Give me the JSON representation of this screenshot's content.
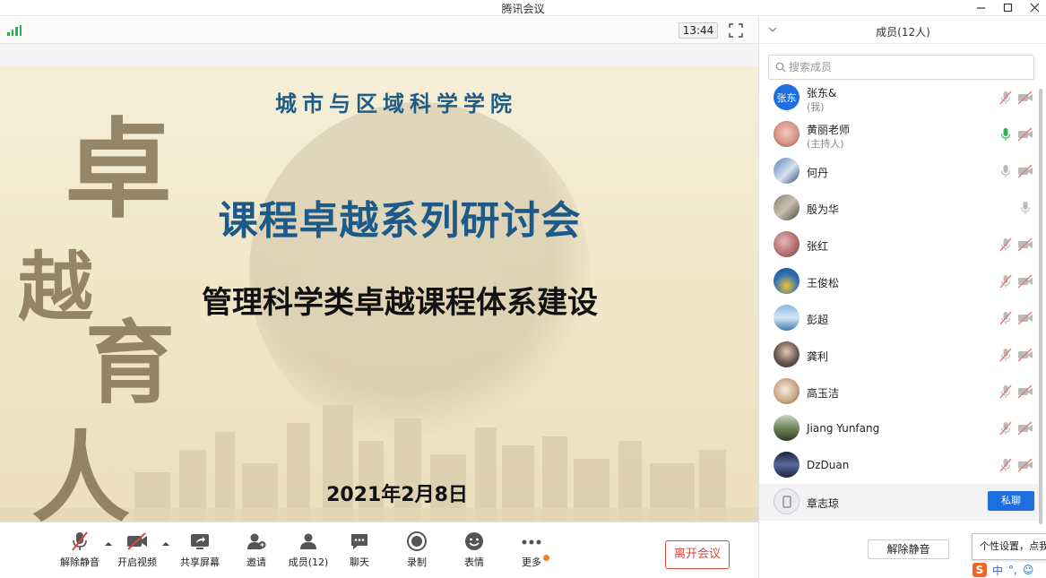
{
  "window": {
    "title": "腾讯会议"
  },
  "topbar": {
    "clock": "13:44"
  },
  "slide": {
    "institute": "城市与区域科学学院",
    "title": "课程卓越系列研讨会",
    "subtitle": "管理科学类卓越课程体系建设",
    "date": "2021年2月8日",
    "calligraphy": [
      "卓",
      "越",
      "育",
      "人"
    ]
  },
  "toolbar": {
    "unmute": "解除静音",
    "start_video": "开启视频",
    "share_screen": "共享屏幕",
    "invite": "邀请",
    "members": "成员(12)",
    "chat": "聊天",
    "record": "录制",
    "reactions": "表情",
    "more": "更多",
    "leave": "离开会议"
  },
  "panel": {
    "title": "成员(12人)",
    "search_placeholder": "搜索成员",
    "unmute_all": "解除静音",
    "tooltip": "个性设置，点我",
    "ime_label": "中",
    "members": [
      {
        "name": "张东&",
        "role": "(我)",
        "avatar_text": "张东",
        "mic": "muted",
        "cam": "off"
      },
      {
        "name": "黄丽老师",
        "role": "(主持人)",
        "mic": "active",
        "cam": "off"
      },
      {
        "name": "何丹",
        "mic": "on",
        "cam": "off"
      },
      {
        "name": "殷为华",
        "mic": "on",
        "cam": "none"
      },
      {
        "name": "张红",
        "mic": "muted",
        "cam": "off"
      },
      {
        "name": "王俊松",
        "mic": "muted",
        "cam": "off"
      },
      {
        "name": "彭超",
        "mic": "muted",
        "cam": "off"
      },
      {
        "name": "龚利",
        "mic": "muted",
        "cam": "off"
      },
      {
        "name": "高玉洁",
        "mic": "muted",
        "cam": "off"
      },
      {
        "name": "Jiang Yunfang",
        "mic": "muted",
        "cam": "off"
      },
      {
        "name": "DzDuan",
        "mic": "muted",
        "cam": "off"
      },
      {
        "name": "章志琼",
        "action": "私聊"
      }
    ]
  },
  "colors": {
    "accent": "#1d6fe0",
    "leave": "#e0443a",
    "mic_active": "#2bb24c",
    "slide_title": "#1c5a8a"
  }
}
